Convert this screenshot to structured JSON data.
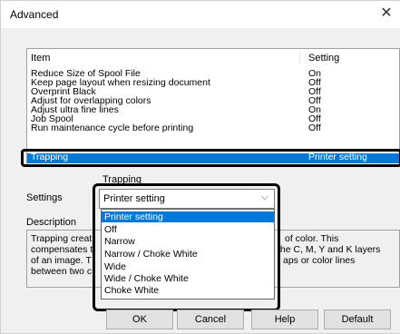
{
  "window": {
    "title": "Advanced",
    "close_glyph": "✕"
  },
  "list": {
    "headers": {
      "item": "Item",
      "setting": "Setting"
    },
    "rows": [
      {
        "item": "Reduce Size of Spool File",
        "setting": "On"
      },
      {
        "item": "Keep page layout when resizing document",
        "setting": "Off"
      },
      {
        "item": "Overprint Black",
        "setting": "Off"
      },
      {
        "item": "Adjust for overlapping colors",
        "setting": "Off"
      },
      {
        "item": "Adjust ultra fine lines",
        "setting": "On"
      },
      {
        "item": "Job Spool",
        "setting": "Off"
      },
      {
        "item": "Run maintenance cycle before printing",
        "setting": "Off"
      },
      {
        "item": "Trapping",
        "setting": "Printer setting"
      }
    ]
  },
  "group": {
    "label": "Trapping"
  },
  "settings": {
    "label": "Settings",
    "value": "Printer setting"
  },
  "dropdown": {
    "options": [
      "Printer setting",
      "Off",
      "Narrow",
      "Narrow / Choke White",
      "Wide",
      "Wide / Choke White",
      "Choke White"
    ]
  },
  "description": {
    "label": "Description",
    "line1_left": "Trapping creat",
    "line1_right": "of color. This",
    "line2_left": "compensates t",
    "line2_right": "the C, M, Y and K layers",
    "line3_left": "of an image. T",
    "line3_right": "aps or color lines",
    "line4_left": "between two c"
  },
  "buttons": {
    "ok": "OK",
    "cancel": "Cancel",
    "help": "Help",
    "default": "Default"
  },
  "colors": {
    "selection": "#0078d7",
    "outline": "#000000"
  }
}
